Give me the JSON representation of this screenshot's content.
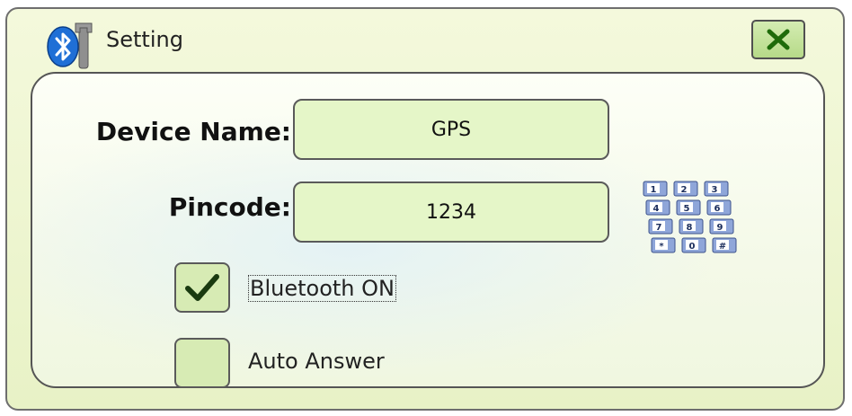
{
  "window": {
    "title": "Setting",
    "icon": "bluetooth-settings-icon",
    "close_icon": "close-x-icon"
  },
  "form": {
    "device_name_label": "Device Name:",
    "device_name_value": "GPS",
    "pincode_label": "Pincode:",
    "pincode_value": "1234",
    "keypad_icon": "numeric-keypad-icon",
    "keypad_keys": [
      "1",
      "2",
      "3",
      "4",
      "5",
      "6",
      "7",
      "8",
      "9",
      "*",
      "0",
      "#"
    ]
  },
  "options": {
    "bluetooth_on_label": "Bluetooth ON",
    "bluetooth_on_checked": true,
    "auto_answer_label": "Auto Answer",
    "auto_answer_checked": false
  },
  "colors": {
    "dialog_bg": "#eaf3ca",
    "field_bg": "#e5f6c8",
    "checkmark": "#1a3a10",
    "close_x": "#1f6b0a",
    "bluetooth_blue": "#1f6fd6"
  }
}
